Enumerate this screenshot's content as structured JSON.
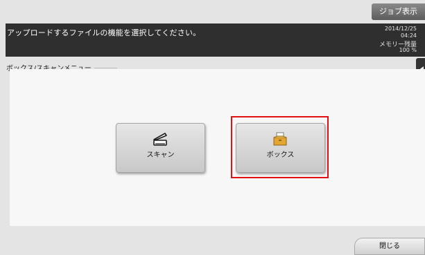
{
  "top_bar": {
    "job_display_label": "ジョブ表示"
  },
  "header": {
    "message": "アップロードするファイルの機能を選択してください。",
    "date": "2014/12/25",
    "time": "04:24",
    "memory_label": "メモリー残量",
    "memory_value": "100 %"
  },
  "panel": {
    "title": "ボックス/スキャンメニュー",
    "buttons": [
      {
        "label": "スキャン",
        "icon": "scanner-icon"
      },
      {
        "label": "ボックス",
        "icon": "box-folder-icon"
      }
    ]
  },
  "footer": {
    "close_label": "閉じる"
  },
  "colors": {
    "header_bg": "#2f2f2f",
    "highlight": "#e01010",
    "panel_bg": "#f7f7f7"
  }
}
